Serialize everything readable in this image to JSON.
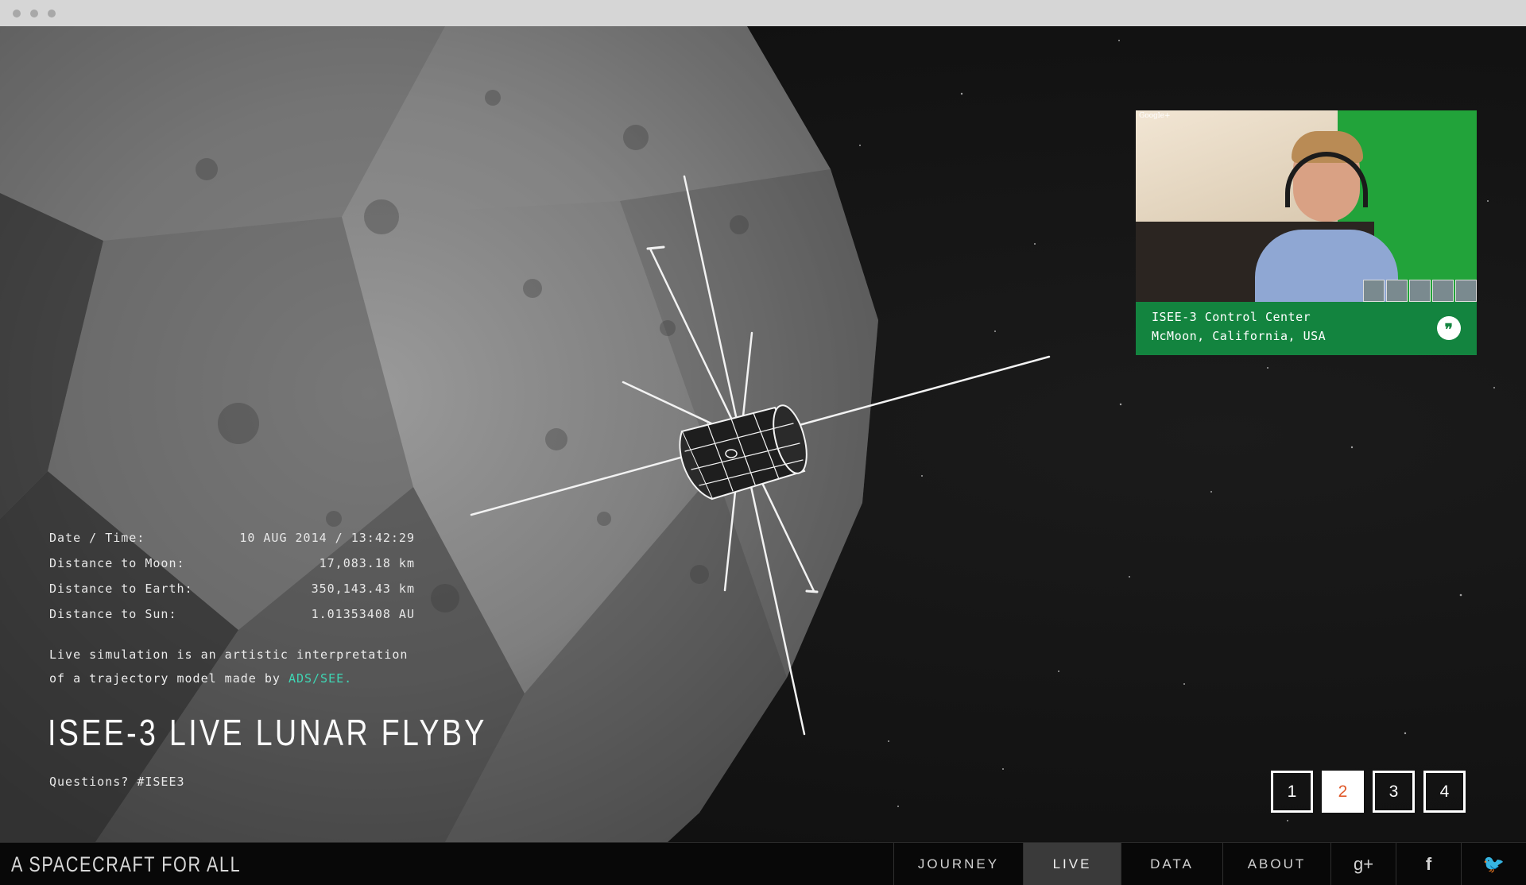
{
  "telemetry": {
    "rows": [
      {
        "label": "Date / Time:",
        "value": "10 AUG 2014 / 13:42:29"
      },
      {
        "label": "Distance to Moon:",
        "value": "17,083.18 km"
      },
      {
        "label": "Distance to Earth:",
        "value": "350,143.43 km"
      },
      {
        "label": "Distance to Sun:",
        "value": "1.01353408 AU"
      }
    ]
  },
  "note": {
    "text_before": "Live simulation is an artistic interpretation of a trajectory model made by ",
    "link": "ADS/SEE."
  },
  "title": "ISEE-3 LIVE LUNAR FLYBY",
  "questions": "Questions? #ISEE3",
  "hangout": {
    "badge": "Google+",
    "line1": "ISEE-3 Control Center",
    "line2": "McMoon, California, USA",
    "icon": "quote-bubble-icon"
  },
  "pager": {
    "pages": [
      "1",
      "2",
      "3",
      "4"
    ],
    "active": "2"
  },
  "footer": {
    "brand": "A SPACECRAFT FOR ALL",
    "nav": [
      "JOURNEY",
      "LIVE",
      "DATA",
      "ABOUT"
    ],
    "active_nav": "LIVE",
    "social": [
      {
        "name": "google-plus-icon",
        "glyph": "g+"
      },
      {
        "name": "facebook-icon",
        "glyph": "f"
      },
      {
        "name": "twitter-icon",
        "glyph": "🐦"
      }
    ]
  },
  "colors": {
    "accent_link": "#3fd6b4",
    "hangout_green": "#13843f",
    "active_page": "#e05a2b"
  }
}
